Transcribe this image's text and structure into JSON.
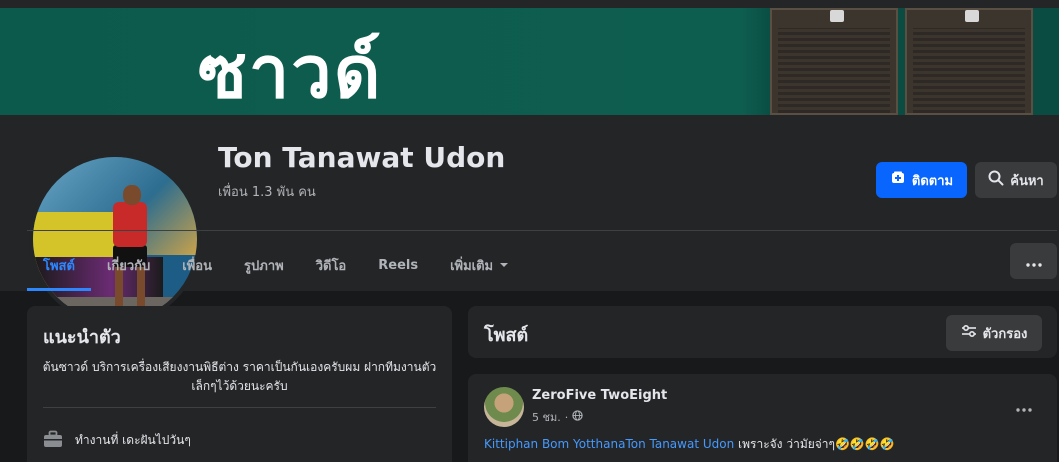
{
  "cover": {
    "text": "ซาวด์"
  },
  "profile": {
    "name": "Ton Tanawat Udon",
    "friends": "เพื่อน 1.3 พัน คน",
    "follow_label": "ติดตาม",
    "search_label": "ค้นหา"
  },
  "tabs": [
    {
      "label": "โพสต์"
    },
    {
      "label": "เกี่ยวกับ"
    },
    {
      "label": "เพื่อน"
    },
    {
      "label": "รูปภาพ"
    },
    {
      "label": "วิดีโอ"
    },
    {
      "label": "Reels"
    },
    {
      "label": "เพิ่มเติม"
    }
  ],
  "intro": {
    "title": "แนะนำตัว",
    "bio": "ต้นซาวด์ บริการเครื่องเสียงงานพิธีต่าง ราคาเป็นกันเองครับผม ฝากทีมงานตัวเล็กๆไว้ด้วยนะครับ",
    "work": "ทำงานที่ เดะฝันไปวันๆ"
  },
  "posts_section": {
    "title": "โพสต์",
    "filter_label": "ตัวกรอง"
  },
  "post": {
    "author": "ZeroFive TwoEight",
    "time": "5 ชม.",
    "mention1": "Kittiphan Bom Yotthana",
    "mention2": "Ton Tanawat Udon",
    "text": " เพราะจัง ว่ามัยจ่าๆ🤣🤣🤣🤣"
  },
  "colors": {
    "accent": "#2d88ff",
    "follow_button": "#0866ff",
    "background": "#18191a",
    "card": "#242526"
  },
  "icons": {
    "follow": "plus-box-icon",
    "search": "search-icon",
    "more": "more-dots-icon",
    "dropdown": "caret-down-icon",
    "filter": "sliders-icon",
    "work": "briefcase-icon",
    "privacy": "globe-icon"
  }
}
